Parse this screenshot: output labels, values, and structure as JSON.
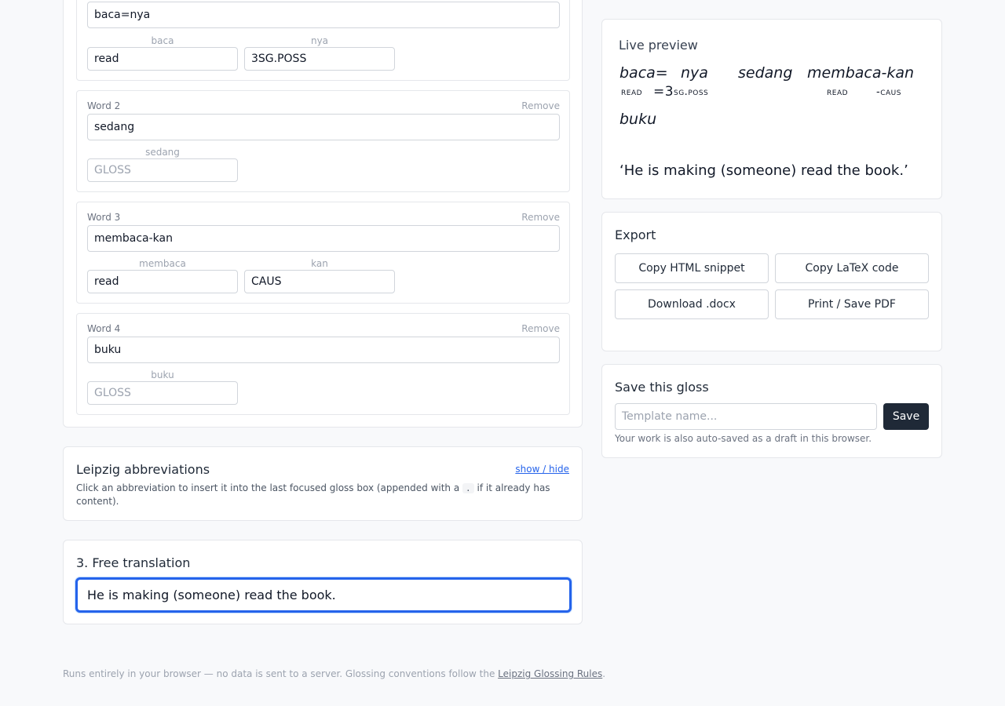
{
  "words": [
    {
      "label": "",
      "remove": "",
      "value": "baca=nya",
      "morphemes": [
        {
          "label": "baca",
          "gloss": "read",
          "placeholder": ""
        },
        {
          "label": "nya",
          "gloss": "3SG.POSS",
          "placeholder": ""
        }
      ]
    },
    {
      "label": "Word 2",
      "remove": "Remove",
      "value": "sedang",
      "morphemes": [
        {
          "label": "sedang",
          "gloss": "",
          "placeholder": "GLOSS"
        }
      ]
    },
    {
      "label": "Word 3",
      "remove": "Remove",
      "value": "membaca-kan",
      "morphemes": [
        {
          "label": "membaca",
          "gloss": "read",
          "placeholder": ""
        },
        {
          "label": "kan",
          "gloss": "CAUS",
          "placeholder": ""
        }
      ]
    },
    {
      "label": "Word 4",
      "remove": "Remove",
      "value": "buku",
      "morphemes": [
        {
          "label": "buku",
          "gloss": "",
          "placeholder": "GLOSS"
        }
      ]
    }
  ],
  "abbreviations": {
    "title": "Leipzig abbreviations",
    "toggle": "show / hide",
    "desc_before": "Click an abbreviation to insert it into the last focused gloss box (appended with a",
    "desc_code": ".",
    "desc_after": "if it already has content)."
  },
  "translation_section": {
    "title": "3. Free translation",
    "value": "He is making (someone) read the book."
  },
  "preview": {
    "title": "Live preview",
    "line1_words": [
      "baca=",
      "nya",
      "sedang",
      "membaca-kan"
    ],
    "line1_gloss": [
      "read",
      "=3",
      "sg.poss",
      "read",
      "-caus"
    ],
    "line2_words": [
      "buku"
    ],
    "translation": "‘He is making (someone) read the book.’"
  },
  "export": {
    "title": "Export",
    "buttons": [
      "Copy HTML snippet",
      "Copy LaTeX code",
      "Download .docx",
      "Print / Save PDF"
    ]
  },
  "save": {
    "title": "Save this gloss",
    "placeholder": "Template name...",
    "button": "Save",
    "note": "Your work is also auto-saved as a draft in this browser."
  },
  "footer": {
    "text": "Runs entirely in your browser — no data is sent to a server. Glossing conventions follow the ",
    "link": "Leipzig Glossing Rules",
    "end": "."
  },
  "colors": {
    "accent": "#2563eb",
    "dark_button": "#1f2937",
    "border": "#e5e7eb"
  }
}
